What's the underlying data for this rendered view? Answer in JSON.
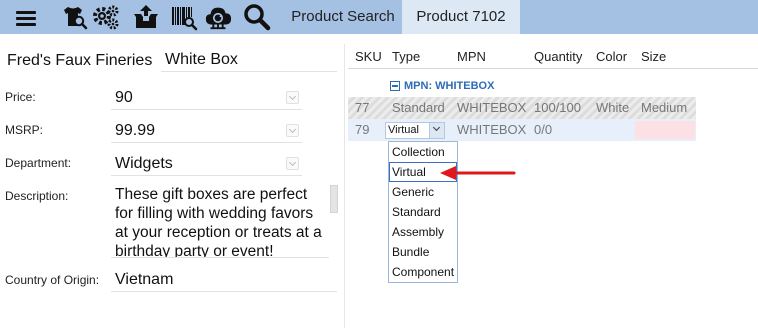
{
  "topbar": {
    "icons": [
      "shirt-search-icon",
      "gears-icon",
      "box-upload-icon",
      "barcode-search-icon",
      "cloud-sync-icon",
      "magnifier-icon"
    ],
    "tabs": [
      {
        "label": "Product Search",
        "active": false
      },
      {
        "label": "Product 7102",
        "active": true
      }
    ]
  },
  "form": {
    "store_name": "Fred's Faux Fineries",
    "product_name": "White Box",
    "price_label": "Price:",
    "price_value": "90",
    "msrp_label": "MSRP:",
    "msrp_value": "99.99",
    "department_label": "Department:",
    "department_value": "Widgets",
    "description_label": "Description:",
    "description_value": "These gift boxes are perfect for filling with wedding favors at your reception or treats at a birthday party or event!",
    "country_label": "Country of Origin:",
    "country_value": "Vietnam"
  },
  "table": {
    "headers": [
      "SKU",
      "Type",
      "MPN",
      "Quantity",
      "Color",
      "Size"
    ],
    "group_label": "MPN: WHITEBOX",
    "rows": [
      {
        "sku": "77",
        "type": "Standard",
        "mpn": "WHITEBOX",
        "quantity": "100/100",
        "color": "White",
        "size": "Medium"
      },
      {
        "sku": "79",
        "type": "Virtual",
        "mpn": "WHITEBOX",
        "quantity": "0/0",
        "color": "",
        "size": ""
      }
    ]
  },
  "type_dropdown": {
    "options": [
      "Collection",
      "Virtual",
      "Generic",
      "Standard",
      "Assembly",
      "Bundle",
      "Component"
    ],
    "highlighted": "Virtual"
  },
  "colors": {
    "topbar": "#a4c0e2",
    "active_tab": "#dde8f5",
    "group_label": "#2c6db5",
    "annotation_arrow": "#e0181e",
    "size_invalid": "#fde0e3"
  }
}
